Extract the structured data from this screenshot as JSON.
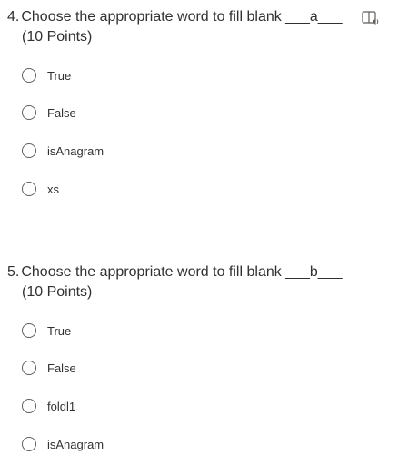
{
  "questions": [
    {
      "number": "4.",
      "title": "Choose the appropriate word to fill blank ___a___",
      "points": "(10 Points)",
      "reader_icon": "immersive-reader-icon",
      "options": [
        {
          "label": "True"
        },
        {
          "label": "False"
        },
        {
          "label": "isAnagram"
        },
        {
          "label": "xs"
        }
      ]
    },
    {
      "number": "5.",
      "title": "Choose the appropriate word to fill blank ___b___",
      "points": "(10 Points)",
      "options": [
        {
          "label": "True"
        },
        {
          "label": "False"
        },
        {
          "label": "foldl1"
        },
        {
          "label": "isAnagram"
        }
      ]
    }
  ],
  "colors": {
    "text": "#323130",
    "radio_border": "#605e5c",
    "background": "#ffffff"
  }
}
